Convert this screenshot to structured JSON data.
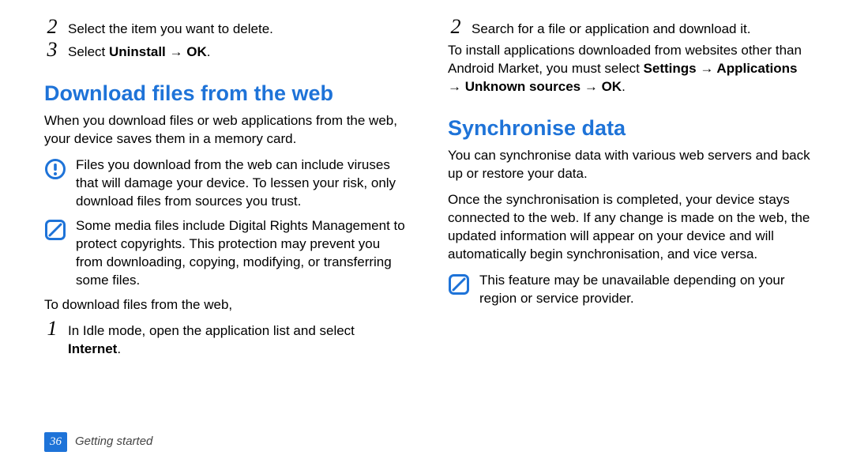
{
  "left": {
    "step2": {
      "num": "2",
      "text": "Select the item you want to delete."
    },
    "step3": {
      "num": "3",
      "prefix": "Select ",
      "bold": "Uninstall → OK",
      "suffix": "."
    },
    "heading": "Download files from the web",
    "intro": "When you download files or web applications from the web, your device saves them in a memory card.",
    "warn": "Files you download from the web can include viruses that will damage your device. To lessen your risk, only download files from sources you trust.",
    "drm": "Some media files include Digital Rights Management to protect copyrights. This protection may prevent you from downloading, copying, modifying, or transferring some files.",
    "lead": "To download files from the web,",
    "step1": {
      "num": "1",
      "prefix": "In Idle mode, open the application list and select ",
      "bold": "Internet",
      "suffix": "."
    }
  },
  "right": {
    "step2": {
      "num": "2",
      "text": "Search for a file or application and download it."
    },
    "install_pre": "To install applications downloaded from websites other than Android Market, you must select ",
    "install_bold": "Settings → Applications → Unknown sources → OK",
    "install_suf": ".",
    "heading": "Synchronise data",
    "sync1": "You can synchronise data with various web servers and back up or restore your data.",
    "sync2": "Once the synchronisation is completed, your device stays connected to the web. If any change is made on the web, the updated information will appear on your device and will automatically begin synchronisation, and vice versa.",
    "note": "This feature may be unavailable depending on your region or service provider."
  },
  "footer": {
    "page": "36",
    "section": "Getting started"
  }
}
